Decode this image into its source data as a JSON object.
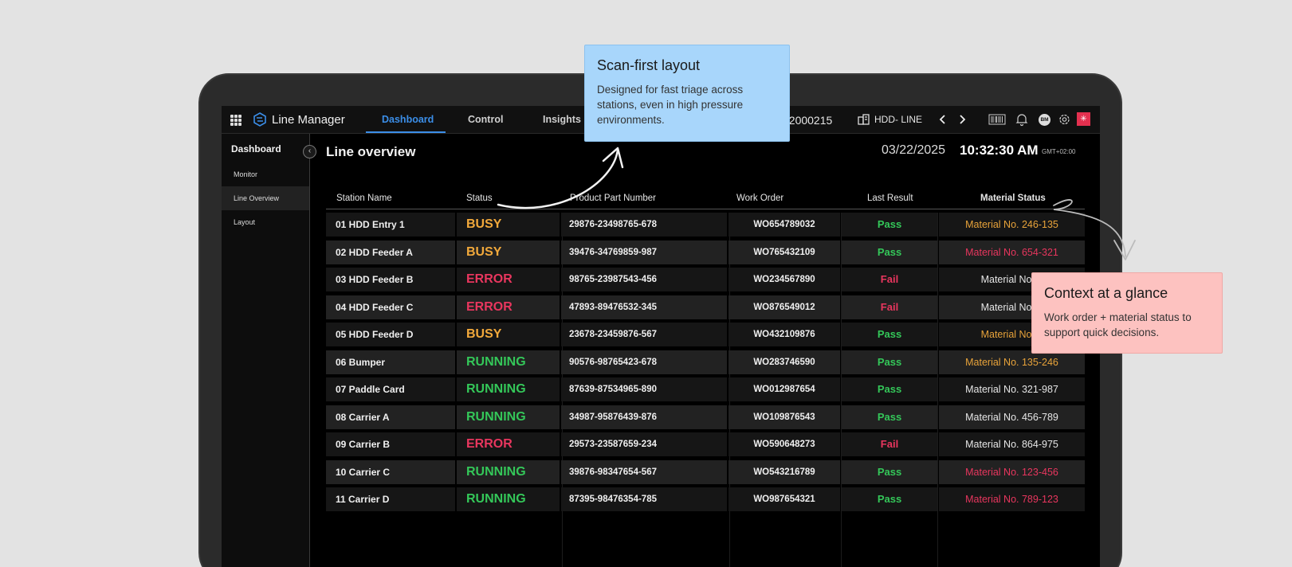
{
  "topbar": {
    "app_name": "Line Manager",
    "tabs": [
      {
        "label": "Dashboard",
        "active": true
      },
      {
        "label": "Control",
        "active": false
      },
      {
        "label": "Insights",
        "active": false
      }
    ],
    "user_id": "ch2000215",
    "line_label": "HDD- LINE",
    "avatar_initials": "BM",
    "accent_color": "#3b8ee8"
  },
  "sidebar": {
    "title": "Dashboard",
    "items": [
      {
        "label": "Monitor",
        "active": false
      },
      {
        "label": "Line Overview",
        "active": true
      },
      {
        "label": "Layout",
        "active": false
      }
    ]
  },
  "main": {
    "title": "Line overview",
    "date": "03/22/2025",
    "time": "10:32:30 AM",
    "timezone": "GMT+02:00"
  },
  "table": {
    "headers": [
      "Station Name",
      "Status",
      "Product Part Number",
      "Work Order",
      "Last Result",
      "Material Status"
    ],
    "rows": [
      {
        "station": "01  HDD Entry 1",
        "status": "BUSY",
        "part": "29876-23498765-678",
        "wo": "WO654789032",
        "result": "Pass",
        "material": "Material No. 246-135",
        "mat_color": "#e8a33a"
      },
      {
        "station": "02  HDD Feeder A",
        "status": "BUSY",
        "part": "39476-34769859-987",
        "wo": "WO765432109",
        "result": "Pass",
        "material": "Material No. 654-321",
        "mat_color": "#e8365e"
      },
      {
        "station": "03  HDD Feeder B",
        "status": "ERROR",
        "part": "98765-23987543-456",
        "wo": "WO234567890",
        "result": "Fail",
        "material": "Material No. 9",
        "mat_color": "#e6e6e6"
      },
      {
        "station": "04  HDD Feeder C",
        "status": "ERROR",
        "part": "47893-89476532-345",
        "wo": "WO876549012",
        "result": "Fail",
        "material": "Material No. 9",
        "mat_color": "#e6e6e6"
      },
      {
        "station": "05  HDD Feeder D",
        "status": "BUSY",
        "part": "23678-23459876-567",
        "wo": "WO432109876",
        "result": "Pass",
        "material": "Material No. 7",
        "mat_color": "#e8a33a"
      },
      {
        "station": "06  Bumper",
        "status": "RUNNING",
        "part": "90576-98765423-678",
        "wo": "WO283746590",
        "result": "Pass",
        "material": "Material No. 135-246",
        "mat_color": "#e8a33a"
      },
      {
        "station": "07  Paddle Card",
        "status": "RUNNING",
        "part": "87639-87534965-890",
        "wo": "WO012987654",
        "result": "Pass",
        "material": "Material No. 321-987",
        "mat_color": "#e6e6e6"
      },
      {
        "station": "08  Carrier A",
        "status": "RUNNING",
        "part": "34987-95876439-876",
        "wo": "WO109876543",
        "result": "Pass",
        "material": "Material No. 456-789",
        "mat_color": "#e6e6e6"
      },
      {
        "station": "09  Carrier B",
        "status": "ERROR",
        "part": "29573-23587659-234",
        "wo": "WO590648273",
        "result": "Fail",
        "material": "Material No. 864-975",
        "mat_color": "#e6e6e6"
      },
      {
        "station": "10  Carrier C",
        "status": "RUNNING",
        "part": "39876-98347654-567",
        "wo": "WO543216789",
        "result": "Pass",
        "material": "Material No. 123-456",
        "mat_color": "#e8365e"
      },
      {
        "station": "11  Carrier D",
        "status": "RUNNING",
        "part": "87395-98476354-785",
        "wo": "WO987654321",
        "result": "Pass",
        "material": "Material No. 789-123",
        "mat_color": "#e8365e"
      }
    ]
  },
  "status_colors": {
    "BUSY": "#f2a93b",
    "ERROR": "#e8365e",
    "RUNNING": "#34c759"
  },
  "result_colors": {
    "Pass": "#34c759",
    "Fail": "#e8365e"
  },
  "callouts": {
    "scan": {
      "title": "Scan-first layout",
      "body": "Designed for fast triage across stations, even in high pressure environments.",
      "color": "#a8d6fb"
    },
    "context": {
      "title": "Context at a glance",
      "body": "Work order + material status to support quick decisions.",
      "color": "#fdc2c0"
    }
  }
}
